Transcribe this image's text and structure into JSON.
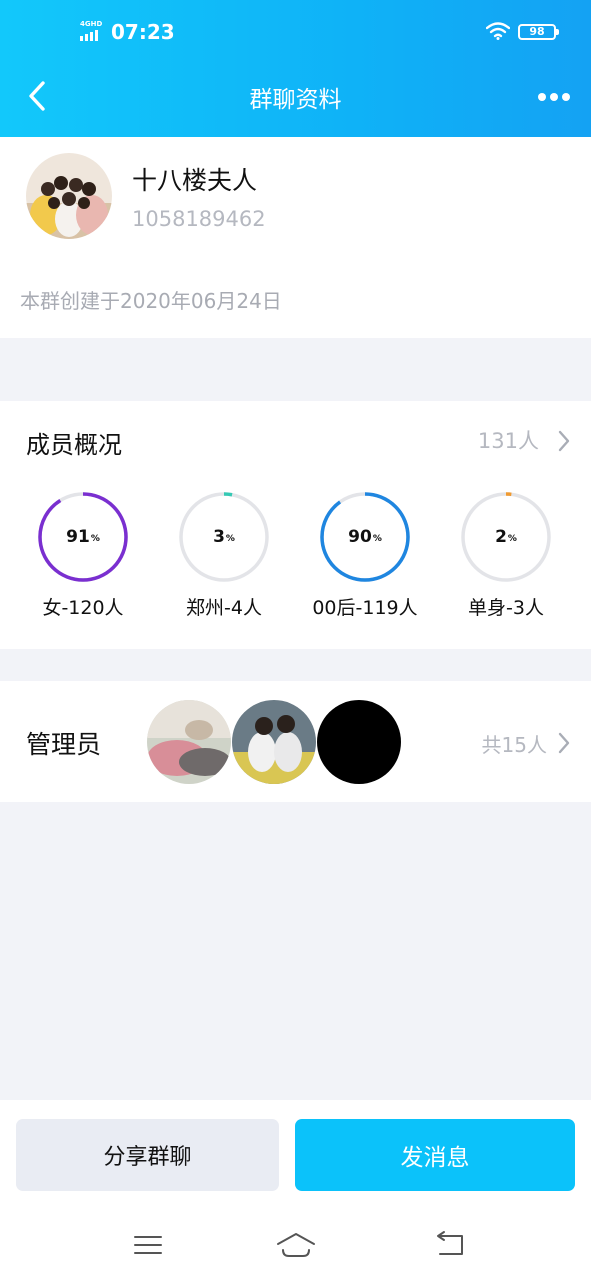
{
  "status_bar": {
    "network": "4GHD",
    "time": "07:23",
    "battery": "98"
  },
  "header": {
    "title": "群聊资料"
  },
  "group": {
    "name": "十八楼夫人",
    "id": "1058189462",
    "created": "本群创建于2020年06月24日"
  },
  "members": {
    "title": "成员概况",
    "count": "131人",
    "stats": [
      {
        "pct": "91",
        "unit": "%",
        "label": "女-120人",
        "value": 0.91,
        "color": "#7a2fd0"
      },
      {
        "pct": "3",
        "unit": "%",
        "label": "郑州-4人",
        "value": 0.03,
        "color": "#35c9b4"
      },
      {
        "pct": "90",
        "unit": "%",
        "label": "00后-119人",
        "value": 0.9,
        "color": "#1f86e0"
      },
      {
        "pct": "2",
        "unit": "%",
        "label": "单身-3人",
        "value": 0.02,
        "color": "#f09a30"
      }
    ]
  },
  "admins": {
    "title": "管理员",
    "count": "共15人"
  },
  "actions": {
    "share": "分享群聊",
    "message": "发消息"
  }
}
